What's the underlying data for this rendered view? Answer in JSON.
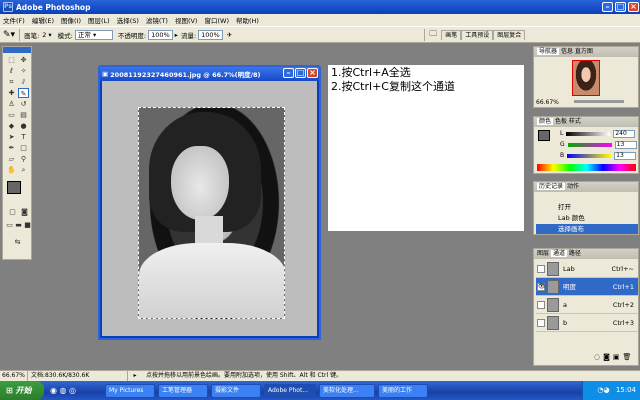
{
  "app": {
    "title": "Adobe Photoshop"
  },
  "menu": [
    "文件(F)",
    "编辑(E)",
    "图像(I)",
    "图层(L)",
    "选择(S)",
    "滤镜(T)",
    "视图(V)",
    "窗口(W)",
    "帮助(H)"
  ],
  "options": {
    "brush_label": "画笔:",
    "brush_size": "2",
    "mode_label": "模式:",
    "mode_value": "正常",
    "opacity_label": "不透明度:",
    "opacity_value": "100%",
    "flow_label": "流量:",
    "flow_value": "100%"
  },
  "palette_well": [
    "画笔",
    "工具预设",
    "图层复合"
  ],
  "document": {
    "title": "20081192327460961.jpg @ 66.7%(明度/8)"
  },
  "instructions": [
    "1.按Ctrl+A全选",
    "2.按Ctrl+C复制这个通道"
  ],
  "navigator": {
    "tabs": [
      "导航器",
      "信息",
      "直方图"
    ],
    "zoom": "66.67%"
  },
  "color_panel": {
    "tabs": [
      "颜色",
      "色板",
      "样式"
    ],
    "sliders": [
      {
        "label": "L",
        "value": "240"
      },
      {
        "label": "G",
        "value": "13"
      },
      {
        "label": "B",
        "value": "13"
      }
    ]
  },
  "history": {
    "tabs": [
      "历史记录",
      "动作"
    ],
    "items": [
      {
        "label": "打开",
        "selected": false
      },
      {
        "label": "Lab 颜色",
        "selected": false
      },
      {
        "label": "选择画布",
        "selected": true
      }
    ]
  },
  "channels": {
    "tabs": [
      "图层",
      "通道",
      "路径"
    ],
    "rows": [
      {
        "name": "Lab",
        "key": "Ctrl+~",
        "selected": false
      },
      {
        "name": "明度",
        "key": "Ctrl+1",
        "selected": true
      },
      {
        "name": "a",
        "key": "Ctrl+2",
        "selected": false
      },
      {
        "name": "b",
        "key": "Ctrl+3",
        "selected": false
      }
    ]
  },
  "status": {
    "zoom": "66.67%",
    "doc": "文档:830.6K/830.6K",
    "hint": "点按并拖移以用前景色绘画。要用附加选项，使用 Shift、Alt 和 Ctrl 键。"
  },
  "taskbar": {
    "start": "开始",
    "tasks": [
      "My Pictures",
      "工笔管理器",
      "摄影文件",
      "Adobe Phot...",
      "美软化处理...",
      "美丽的工作"
    ],
    "time": "15:04"
  }
}
